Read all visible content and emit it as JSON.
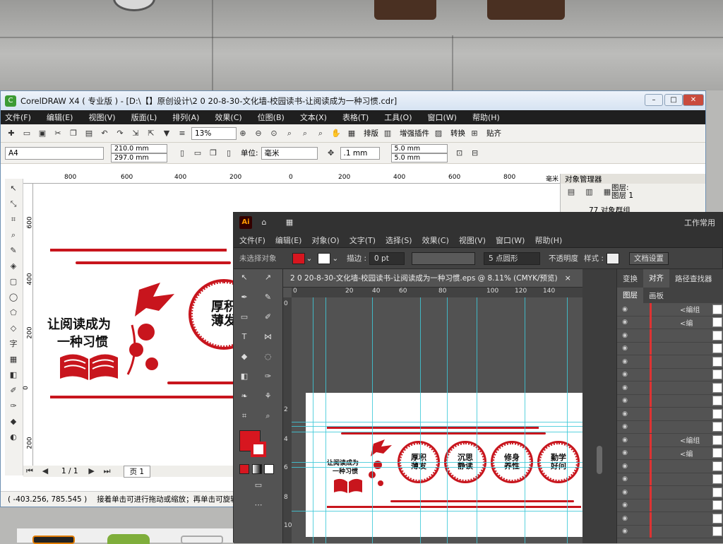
{
  "cdr": {
    "title": "CorelDRAW X4 ( 专业版 ) - [D:\\【】原创设计\\2 0 20-8-30-文化墙-校园读书-让阅读成为一种习惯.cdr]",
    "menu": [
      "文件(F)",
      "编辑(E)",
      "视图(V)",
      "版面(L)",
      "排列(A)",
      "效果(C)",
      "位图(B)",
      "文本(X)",
      "表格(T)",
      "工具(O)",
      "窗口(W)",
      "帮助(H)"
    ],
    "zoom": "13%",
    "toolbar_right": [
      "排版",
      "增强插件",
      "转换",
      "贴齐"
    ],
    "paper": "A4",
    "width": "210.0 mm",
    "height": "297.0 mm",
    "unit_label": "单位:",
    "unit": "毫米",
    "nudge": ".1 mm",
    "dup_x": "5.0 mm",
    "dup_y": "5.0 mm",
    "ruler": [
      "800",
      "600",
      "400",
      "200",
      "0",
      "200",
      "400",
      "600",
      "800"
    ],
    "ruler_unit": "毫米",
    "vruler": [
      "600",
      "400",
      "200",
      "0",
      "200"
    ],
    "obj_manager": "对象管理器",
    "layer1": "图层:",
    "layer2": "图层 1",
    "group": "77 对象群组",
    "page_nav": "1 / 1",
    "page_tab": "页 1",
    "status_coords": "( -403.256, 785.545 )",
    "status_text": "接着单击可进行拖动或缩放；再单击可旋转或倾"
  },
  "art": {
    "slogan1": "让阅读成为",
    "slogan2": "一种习惯",
    "seal1": "厚积\n薄发",
    "seal2": "沉思\n静读",
    "seal3": "修身\n养性",
    "seal4": "勤学\n好问"
  },
  "ai": {
    "logo": "Ai",
    "workspace": "工作常用",
    "menu": [
      "文件(F)",
      "编辑(E)",
      "对象(O)",
      "文字(T)",
      "选择(S)",
      "效果(C)",
      "视图(V)",
      "窗口(W)",
      "帮助(H)"
    ],
    "no_selection": "未选择对象",
    "stroke_label": "描边 :",
    "stroke_value": "0 pt",
    "brush": "5 点圆形",
    "opacity": "不透明度",
    "style": "样式 :",
    "doc_settings": "文档设置",
    "doc_tab": "2 0 20-8-30-文化墙-校园读书-让阅读成为一种习惯.eps @ 8.11% (CMYK/预览)",
    "close": "×",
    "hruler": [
      "0",
      "20",
      "40",
      "60",
      "80",
      "100",
      "120",
      "140"
    ],
    "vruler": [
      "0",
      "2",
      "4",
      "6",
      "8",
      "10"
    ],
    "panel_tabs": [
      "变换",
      "对齐",
      "路径查找器"
    ],
    "layer_tabs": [
      "图层",
      "画板"
    ],
    "layers": [
      "<编组",
      "<编",
      "",
      "",
      "",
      "",
      "",
      "",
      "",
      "",
      "<编组",
      "<编",
      "",
      "",
      "",
      "",
      "",
      ""
    ]
  },
  "colors": {
    "red": "#c8151d",
    "accent": "#d7161f"
  }
}
